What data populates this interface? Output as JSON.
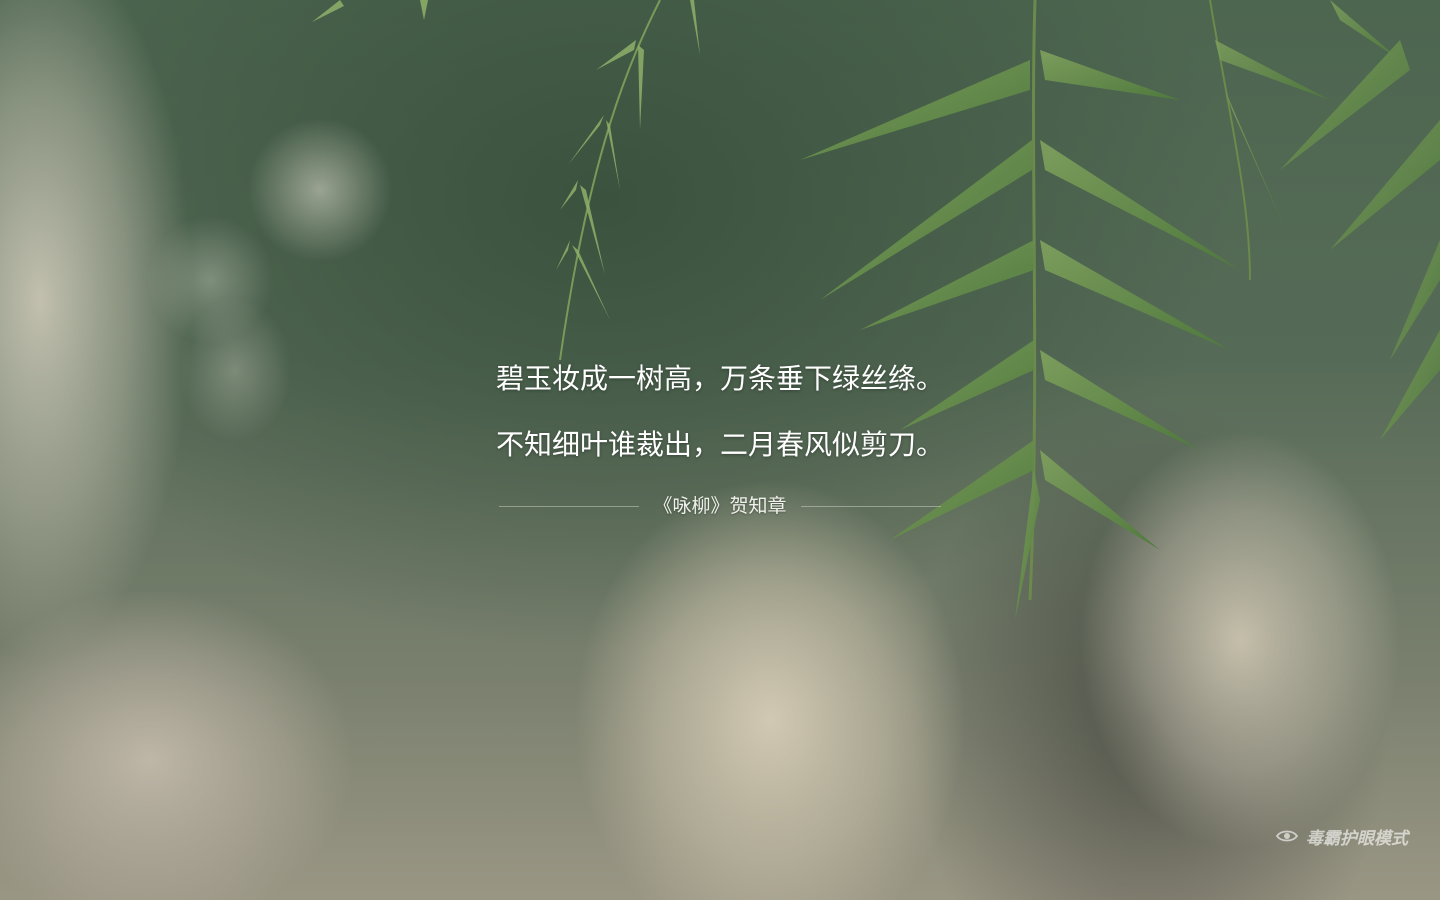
{
  "background": {
    "description_icon": "willow-leaves-bokeh-background",
    "accent_color": "#4d6650"
  },
  "poem": {
    "lines": [
      "碧玉妆成一树高，万条垂下绿丝绦。",
      "不知细叶谁裁出，二月春风似剪刀。"
    ],
    "attribution": "《咏柳》贺知章"
  },
  "eye_mode": {
    "icon": "eye-icon",
    "label": "毒霸护眼模式"
  }
}
